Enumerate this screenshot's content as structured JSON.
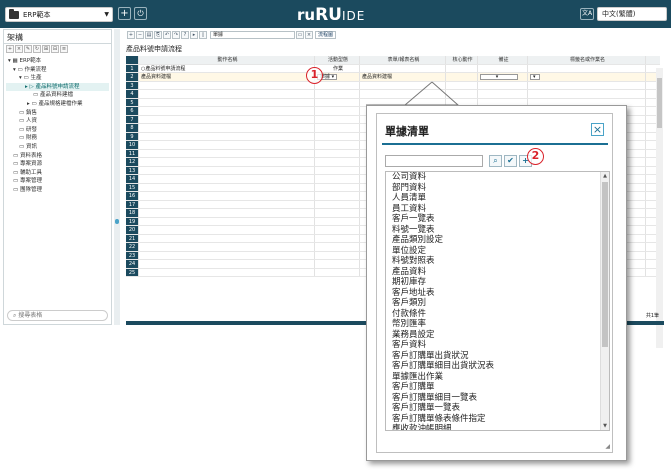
{
  "topbar": {
    "project_label": "ERP範本",
    "logo_prefix": "ru",
    "logo_main": "RU",
    "logo_suffix": "IDE",
    "language": "中文(繁體)",
    "lang_icon": "translate-icon",
    "add_icon": "plus-icon",
    "power_icon": "power-icon"
  },
  "left": {
    "title": "架構",
    "search_placeholder": "搜尋表格",
    "tree": [
      "ERP範本",
      "作業流程",
      "生產",
      "產品料號申請流程",
      "產品資料建檔",
      "產品規格建檔作業",
      "銷售",
      "人資",
      "研發",
      "財務",
      "資訊",
      "資料表格",
      "專案資源",
      "輔助工具",
      "專案管理",
      "團隊管理"
    ]
  },
  "right": {
    "doc_name": "單據",
    "flow_btn": "流程圖",
    "sheet_title": "產品料號申請流程",
    "columns": [
      "動作名稱",
      "活動型態",
      "表單/報表名稱",
      "核心動作",
      "備註",
      "標籤名或作業名"
    ],
    "row1": {
      "c1": "○產品料號申請流程",
      "c2": "作業"
    },
    "row2": {
      "c1": "產品資料建檔",
      "c2": "單據",
      "c3": "產品資料建檔"
    },
    "row_numbers": [
      "1",
      "2",
      "3",
      "4",
      "5",
      "6",
      "7",
      "8",
      "9",
      "10",
      "11",
      "12",
      "13",
      "14",
      "15",
      "16",
      "17",
      "18",
      "19",
      "20",
      "21",
      "22",
      "23",
      "24",
      "25"
    ],
    "page_indicator": "共1筆"
  },
  "callouts": {
    "one": "1",
    "two": "2"
  },
  "dialog": {
    "title": "單據清單",
    "items": [
      "公司資料",
      "部門資料",
      "人員清單",
      "員工資料",
      "客戶一覽表",
      "料號一覽表",
      "產品類別設定",
      "單位設定",
      "料號對照表",
      "產品資料",
      "期初庫存",
      "客戶地址表",
      "客戶類別",
      "付款條件",
      "幣別匯率",
      "業務員設定",
      "客戶資料",
      "客戶訂購單出貨狀況",
      "客戶訂購單細目出貨狀況表",
      "單據匯出作業",
      "客戶訂購單",
      "客戶訂購單細目一覽表",
      "客戶訂購單一覽表",
      "客戶訂購單條表條件指定",
      "應收款沖帳明細"
    ]
  }
}
